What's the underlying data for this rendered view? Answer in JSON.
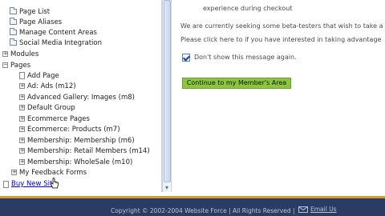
{
  "tree": {
    "items": [
      {
        "label": "Page List",
        "icon": "folder-icon"
      },
      {
        "label": "Page Aliases",
        "icon": "folder-icon"
      },
      {
        "label": "Manage Content Areas",
        "icon": "folder-icon"
      },
      {
        "label": "Social Media Integration",
        "icon": "folder-icon"
      },
      {
        "label": "Modules",
        "icon": "expand-plus-icon"
      },
      {
        "label": "Pages",
        "icon": "collapse-minus-icon"
      },
      {
        "label": "Add Page",
        "icon": "page-icon"
      },
      {
        "label": "Ad: Ads (m12)",
        "icon": "expand-plus-icon"
      },
      {
        "label": "Advanced Gallery: Images (m8)",
        "icon": "expand-plus-icon"
      },
      {
        "label": "Default Group",
        "icon": "expand-plus-icon"
      },
      {
        "label": "Ecommerce Pages",
        "icon": "expand-plus-icon"
      },
      {
        "label": "Ecommerce: Products (m7)",
        "icon": "expand-plus-icon"
      },
      {
        "label": "Membership: Membership (m6)",
        "icon": "expand-plus-icon"
      },
      {
        "label": "Membership: Retail Members (m14)",
        "icon": "expand-plus-icon"
      },
      {
        "label": "Membership: WholeSale (m10)",
        "icon": "expand-plus-icon"
      },
      {
        "label": "My Feedback Forms",
        "icon": "expand-plus-icon"
      }
    ],
    "buy_new_site": "Buy New Site"
  },
  "content": {
    "line1": "experience during checkout",
    "line2": "We are currently seeking some beta-testers that wish to take a",
    "line3": "Please click here to if you have interested in taking advantage",
    "checkbox_label": "Don't show this message again.",
    "checkbox_checked": true,
    "continue_button": "Continue to my Member's Area"
  },
  "footer": {
    "copyright": "Copyright © 2002-2004 Website Force | All Rights Reserved |",
    "email": "Email Us"
  },
  "colors": {
    "button": "#8cc63f",
    "footer_bar": "#2b3c63",
    "footer_accent": "#d89a2a",
    "link": "#0000cc"
  }
}
